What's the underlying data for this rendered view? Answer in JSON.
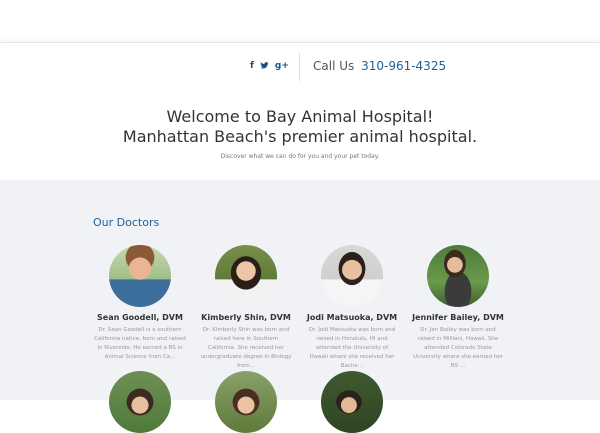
{
  "header": {
    "social_icons": [
      {
        "icon": "facebook-icon",
        "glyph": "f"
      },
      {
        "icon": "twitter-icon",
        "glyph": "🐦"
      },
      {
        "icon": "google-plus-icon",
        "glyph": "g+"
      }
    ],
    "call_label": "Call Us",
    "phone": "310-961-4325"
  },
  "hero": {
    "line1": "Welcome to Bay Animal Hospital!",
    "line2": "Manhattan Beach's premier animal hospital.",
    "tagline": "Discover what we can do for you and your pet today."
  },
  "doctors": {
    "title": "Our Doctors",
    "items": [
      {
        "name": "Sean Goodell, DVM",
        "bio": "Dr. Sean Goodell is a southern California native, born and raised in Riverside. He earned a BS in Animal Science from Ca..."
      },
      {
        "name": "Kimberly Shin, DVM",
        "bio": "Dr. Kimberly Shin was born and raised here in Southern California. She received her undergraduate degree in Biology from..."
      },
      {
        "name": "Jodi Matsuoka, DVM",
        "bio": "Dr. Jodi Matsuoka was born and raised in Honolulu, HI and attended the University of Hawaii where she received her Bache..."
      },
      {
        "name": "Jennifer Bailey, DVM",
        "bio": "Dr. Jen Bailey was born and raised in Mililani, Hawaii. She attended Colorado State University where she earned her BS ..."
      }
    ]
  },
  "colors": {
    "accent": "#1f5f99",
    "section_bg": "#f0f2f5"
  }
}
